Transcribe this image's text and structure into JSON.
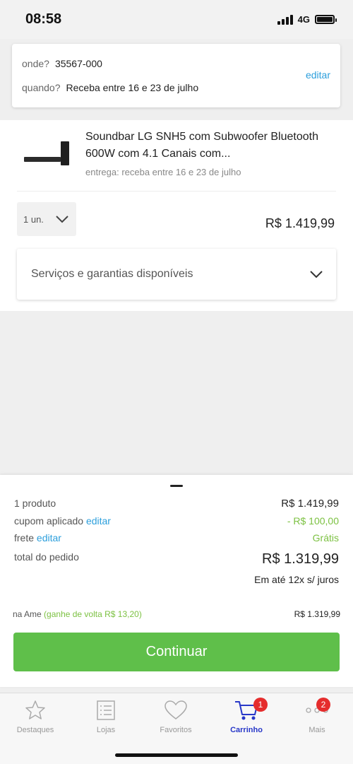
{
  "status": {
    "time": "08:58",
    "network": "4G"
  },
  "delivery": {
    "where_label": "onde?",
    "where_value": "35567-000",
    "when_label": "quando?",
    "when_value": "Receba entre 16 e 23 de julho",
    "edit": "editar"
  },
  "product": {
    "title": "Soundbar LG SNH5 com Subwoofer Bluetooth 600W com 4.1 Canais com...",
    "delivery": "entrega: receba entre 16 e 23 de julho",
    "quantity": "1 un.",
    "price": "R$ 1.419,99",
    "services": "Serviços e garantias disponíveis"
  },
  "summary": {
    "products_label": "1 produto",
    "products_value": "R$ 1.419,99",
    "coupon_label": "cupom aplicado",
    "coupon_edit": "editar",
    "coupon_value": "- R$ 100,00",
    "shipping_label": "frete",
    "shipping_edit": "editar",
    "shipping_value": "Grátis",
    "total_label": "total do pedido",
    "total_value": "R$ 1.319,99",
    "installments": "Em até 12x s/ juros",
    "ame_label": "na Ame",
    "ame_cashback": "(ganhe de volta R$ 13,20)",
    "ame_value": "R$ 1.319,99",
    "continue": "Continuar"
  },
  "tabs": [
    {
      "label": "Destaques",
      "icon": "star-icon"
    },
    {
      "label": "Lojas",
      "icon": "list-icon"
    },
    {
      "label": "Favoritos",
      "icon": "heart-icon"
    },
    {
      "label": "Carrinho",
      "icon": "cart-icon",
      "badge": "1",
      "active": true
    },
    {
      "label": "Mais",
      "icon": "more-icon",
      "badge": "2"
    }
  ],
  "colors": {
    "accent_blue": "#2737c8",
    "link": "#2c9fdc",
    "green": "#5fbf4a",
    "badge": "#e52d2d"
  }
}
